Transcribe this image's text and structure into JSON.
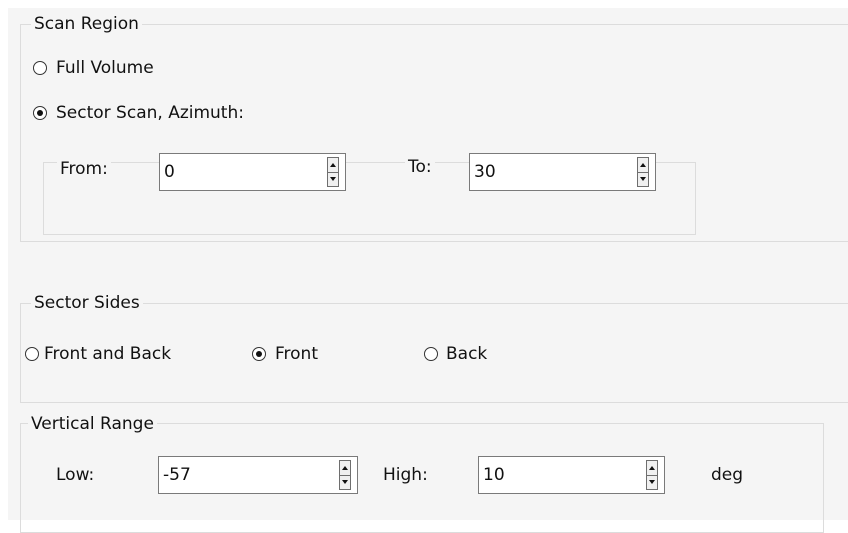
{
  "scan_region": {
    "title": "Scan Region",
    "full_volume_label": "Full Volume",
    "full_volume_selected": false,
    "sector_scan_label": "Sector Scan, Azimuth:",
    "sector_scan_selected": true,
    "from_label": "From:",
    "from_value": "0",
    "to_label": "To:",
    "to_value": "30"
  },
  "sector_sides": {
    "title": "Sector Sides",
    "options": [
      {
        "label": "Front and Back",
        "selected": false
      },
      {
        "label": "Front",
        "selected": true
      },
      {
        "label": "Back",
        "selected": false
      }
    ]
  },
  "vertical_range": {
    "title": "Vertical Range",
    "low_label": "Low:",
    "low_value": "-57",
    "high_label": "High:",
    "high_value": "10",
    "unit_label": "deg"
  },
  "icons": {
    "radio_unchecked": "radio-unchecked-icon",
    "radio_checked": "radio-checked-icon",
    "spin_up": "triangle-up-icon",
    "spin_down": "triangle-down-icon"
  }
}
